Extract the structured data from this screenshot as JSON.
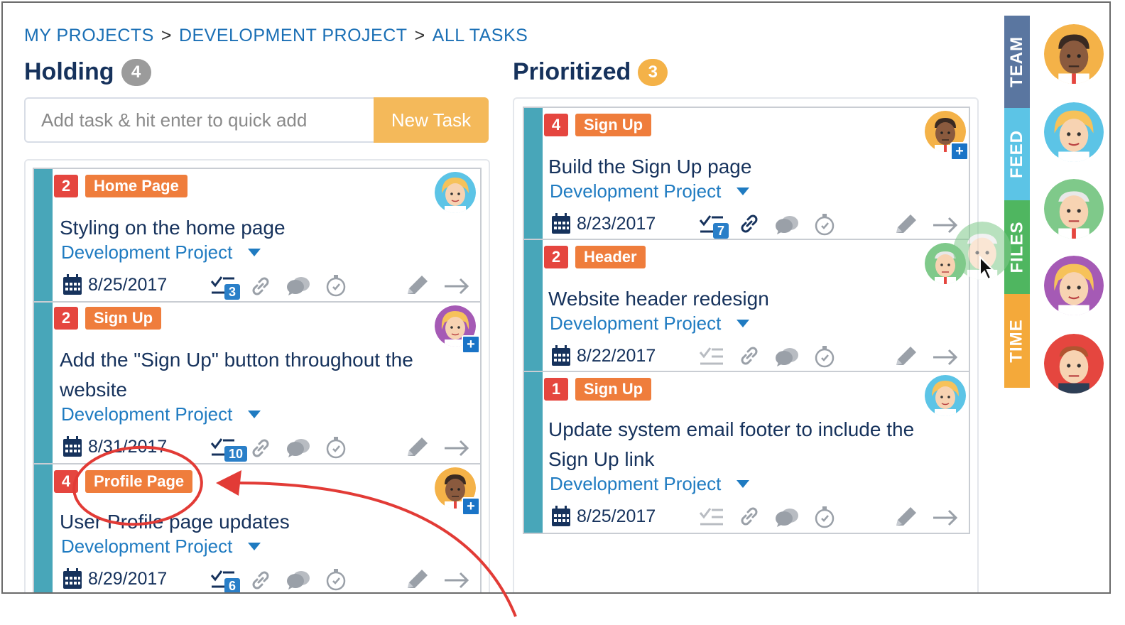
{
  "breadcrumb": {
    "items": [
      "MY PROJECTS",
      "DEVELOPMENT PROJECT",
      "ALL TASKS"
    ],
    "separator": ">"
  },
  "columns": [
    {
      "title": "Holding",
      "count": "4",
      "count_color": "#9b9b9b"
    },
    {
      "title": "Prioritized",
      "count": "3",
      "count_color": "#f4b248"
    }
  ],
  "quick_add": {
    "placeholder": "Add task & hit enter to quick add",
    "button_label": "New Task"
  },
  "holding_cards": [
    {
      "priority": "2",
      "tag": "Home Page",
      "title": "Styling on the home page",
      "project": "Development Project",
      "date": "8/25/2017",
      "checklist_count": "3",
      "avatar": "blonde-woman"
    },
    {
      "priority": "2",
      "tag": "Sign Up",
      "title": "Add the \"Sign Up\" button throughout the website",
      "project": "Development Project",
      "date": "8/31/2017",
      "checklist_count": "10",
      "avatar": "purple-haired-woman"
    },
    {
      "priority": "4",
      "tag": "Profile Page",
      "title": "User Profile page updates",
      "project": "Development Project",
      "date": "8/29/2017",
      "checklist_count": "6",
      "avatar": "dark-skinned-man"
    }
  ],
  "prioritized_cards": [
    {
      "priority": "4",
      "tag": "Sign Up",
      "title": "Build the Sign Up page",
      "project": "Development Project",
      "date": "8/23/2017",
      "checklist_count": "7",
      "avatar": "dark-skinned-man"
    },
    {
      "priority": "2",
      "tag": "Header",
      "title": "Website header redesign",
      "project": "Development Project",
      "date": "8/22/2017",
      "checklist_count": "",
      "avatar": "green-bald-man"
    },
    {
      "priority": "1",
      "tag": "Sign Up",
      "title": "Update system email footer to include the Sign Up link",
      "project": "Development Project",
      "date": "8/25/2017",
      "checklist_count": "",
      "avatar": "blonde-woman"
    }
  ],
  "side_tabs": [
    {
      "label": "TEAM",
      "color": "#5a76a0"
    },
    {
      "label": "FEED",
      "color": "#5cc4e6"
    },
    {
      "label": "FILES",
      "color": "#4fb660"
    },
    {
      "label": "TIME",
      "color": "#f4a93a"
    }
  ],
  "team_avatars": [
    "dark-skinned-man",
    "blonde-woman",
    "green-bald-man",
    "purple-haired-woman",
    "red-man"
  ],
  "colors": {
    "accent": "#1f7bc1",
    "stripe": "#48a6b9",
    "priority": "#e5463f",
    "tag": "#ef7d3c",
    "annotation": "#e23b36"
  }
}
